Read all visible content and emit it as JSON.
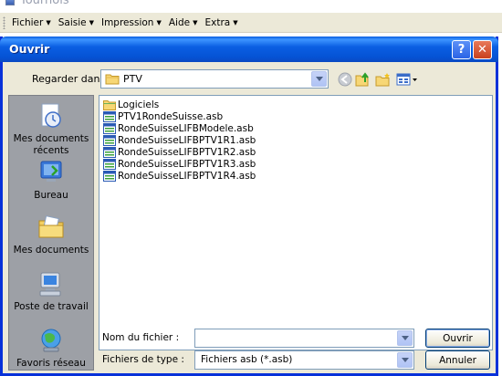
{
  "app": {
    "title": "Tournois",
    "menu": [
      {
        "label": "Fichier"
      },
      {
        "label": "Saisie"
      },
      {
        "label": "Impression"
      },
      {
        "label": "Aide"
      },
      {
        "label": "Extra"
      }
    ]
  },
  "dialog": {
    "title": "Ouvrir",
    "help_label": "?",
    "close_label": "✕",
    "look_in_label": "Regarder dans :",
    "look_in_value": "PTV",
    "places": [
      {
        "label": "Mes documents récents",
        "icon": "recent-documents-icon"
      },
      {
        "label": "Bureau",
        "icon": "desktop-icon"
      },
      {
        "label": "Mes documents",
        "icon": "my-documents-icon"
      },
      {
        "label": "Poste de travail",
        "icon": "my-computer-icon"
      },
      {
        "label": "Favoris réseau",
        "icon": "network-places-icon"
      }
    ],
    "files": [
      {
        "name": "Logiciels",
        "type": "folder"
      },
      {
        "name": "PTV1RondeSuisse.asb",
        "type": "asb"
      },
      {
        "name": "RondeSuisseLIFBModele.asb",
        "type": "asb"
      },
      {
        "name": "RondeSuisseLIFBPTV1R1.asb",
        "type": "asb"
      },
      {
        "name": "RondeSuisseLIFBPTV1R2.asb",
        "type": "asb"
      },
      {
        "name": "RondeSuisseLIFBPTV1R3.asb",
        "type": "asb"
      },
      {
        "name": "RondeSuisseLIFBPTV1R4.asb",
        "type": "asb"
      }
    ],
    "filename_label": "Nom du fichier :",
    "filename_value": "",
    "filetype_label": "Fichiers de type :",
    "filetype_value": "Fichiers asb (*.asb)",
    "open_label": "Ouvrir",
    "cancel_label": "Annuler"
  },
  "colors": {
    "titlebar": "#0553d5",
    "dialog_bg": "#ece9d8",
    "places_bg": "#9da0a6"
  }
}
